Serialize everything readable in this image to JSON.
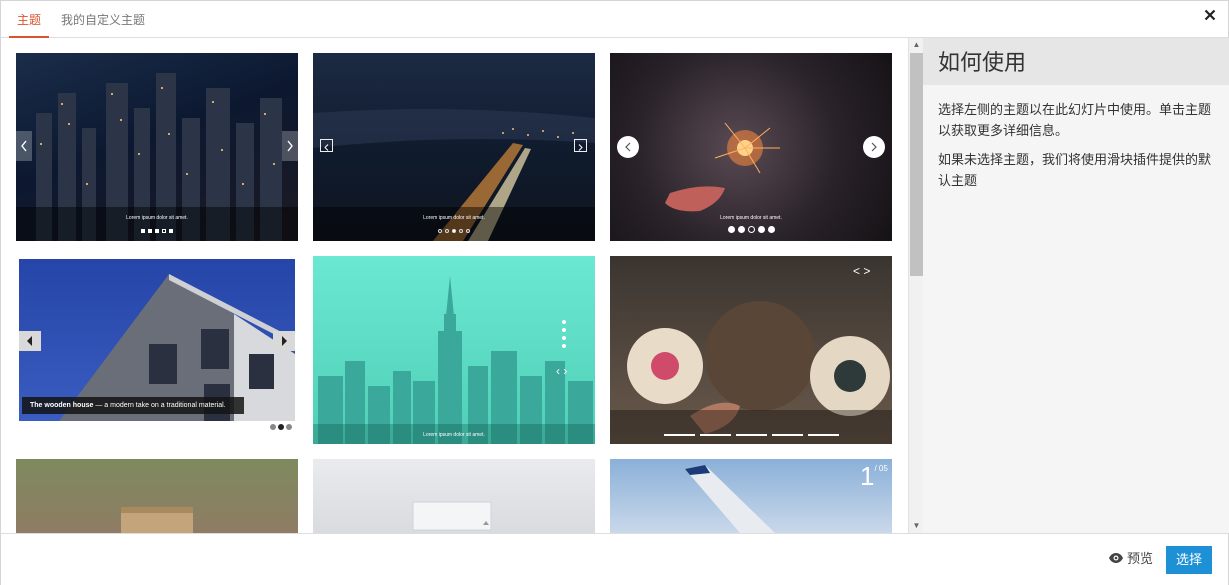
{
  "tabs": [
    {
      "label": "主题",
      "active": true
    },
    {
      "label": "我的自定义主题",
      "active": false
    }
  ],
  "close_icon": "close-icon",
  "themes": [
    {
      "caption": "Lorem ipsum dolor sit amet."
    },
    {
      "caption": "Lorem ipsum dolor sit amet."
    },
    {
      "caption": "Lorem ipsum dolor sit amet."
    },
    {
      "caption": "The wooden house",
      "caption_rest": " — a modern take on a traditional material."
    },
    {
      "caption": "Lorem ipsum dolor sit amet."
    },
    {
      "caption": ""
    },
    {
      "caption": ""
    },
    {
      "caption": ""
    },
    {
      "counter": "1",
      "counter_total": "/ 05"
    }
  ],
  "help": {
    "title": "如何使用",
    "paragraph1": "选择左侧的主题以在此幻灯片中使用。单击主题以获取更多详细信息。",
    "paragraph2": "如果未选择主题，我们将使用滑块插件提供的默认主题"
  },
  "footer": {
    "preview_label": "预览",
    "preview_icon": "eye-icon",
    "select_label": "选择"
  },
  "colors": {
    "accent": "#d9532e",
    "primary_button": "#1e90d6"
  }
}
